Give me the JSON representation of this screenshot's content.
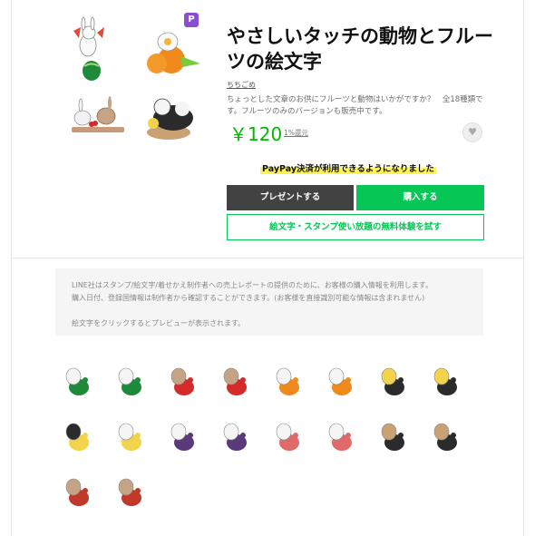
{
  "product": {
    "title": "やさしいタッチの動物とフルーツの絵文字",
    "author": "ちちごめ",
    "description": "ちょっとした文章のお供にフルーツと動物はいかがですか？　全18種類です。フルーツのみのバージョンも販売中です。",
    "price": "￥120",
    "points": "1%還元",
    "premium_badge": "P"
  },
  "promo": {
    "paypay_text": "PayPay決済が利用できるようになりました"
  },
  "actions": {
    "gift_label": "プレゼントする",
    "buy_label": "購入する",
    "trial_label": "絵文字・スタンプ使い放題の無料体験を試す"
  },
  "notice": {
    "line1": "LINE社はスタンプ/絵文字/着せかえ制作者への売上レポートの提供のために、お客様の購入情報を利用します。",
    "line2": "購入日付、登録国情報は制作者から確認することができます。(お客様を直接識別可能な情報は含まれません)",
    "line3": "絵文字をクリックするとプレビューが表示されます。"
  },
  "emoji_grid": {
    "count": 18,
    "items": [
      "rabbit-watermelon",
      "rabbit-watermelon-small",
      "animals-cherries",
      "animals-cherries-small",
      "chick-orange",
      "chick-orange-small",
      "panda-basket",
      "panda-banana",
      "penguin-lemon",
      "chick-lemon",
      "cow-grapes",
      "cows-grapes",
      "rabbits-strawberries",
      "rabbit-strawberry",
      "panda-pear",
      "panda-sleeping",
      "squirrel-cherries",
      "squirrel-cherries-small"
    ]
  },
  "colors": {
    "accent_green": "#06c755",
    "price_green": "#00b900",
    "gift_button": "#424242",
    "premium_purple": "#8a4fcf",
    "highlight_yellow": "#fff34d"
  }
}
